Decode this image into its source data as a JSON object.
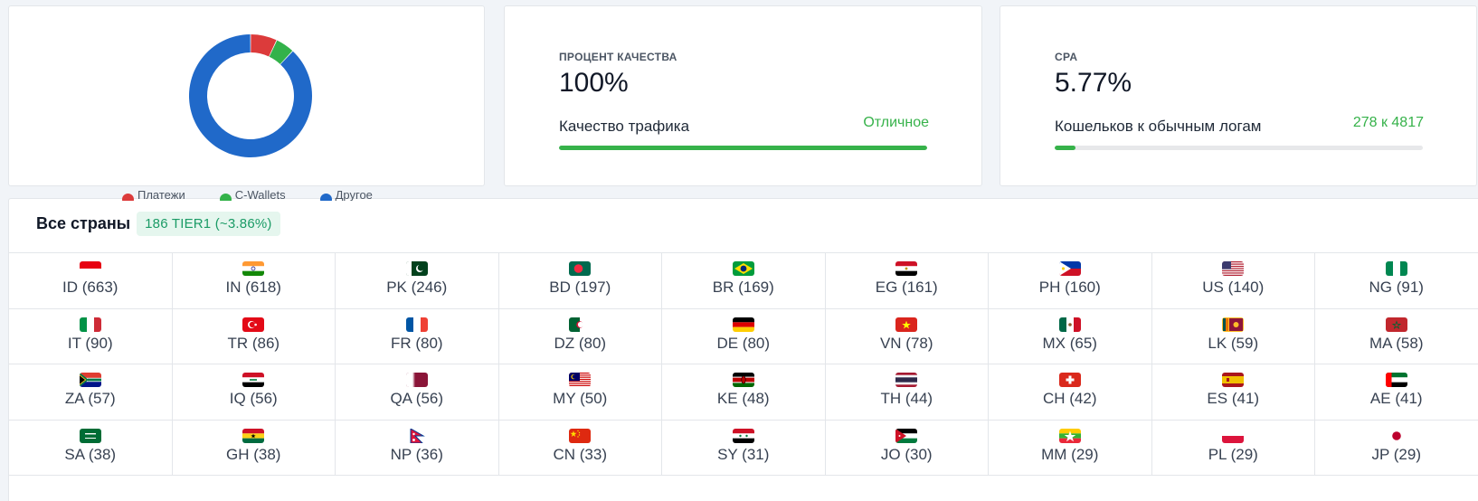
{
  "donut_card": {
    "segments": [
      {
        "name": "Платежи",
        "value": 7,
        "color": "#dc3b3b"
      },
      {
        "name": "C-Wallets",
        "value": 5,
        "color": "#33b24a"
      },
      {
        "name": "Другое",
        "value": 88,
        "color": "#2069c9"
      }
    ],
    "legend": [
      {
        "label": "Платежи",
        "color": "#dc3b3b"
      },
      {
        "label": "C-Wallets",
        "color": "#33b24a"
      },
      {
        "label": "Другое",
        "color": "#2069c9"
      }
    ]
  },
  "quality_card": {
    "title": "ПРОЦЕНТ КАЧЕСТВА",
    "value": "100%",
    "label": "Качество трафика",
    "status": "Отличное",
    "progress": 1.0
  },
  "cpa_card": {
    "title": "CPA",
    "value": "5.77%",
    "label": "Кошельков к обычным логам",
    "status": "278 к 4817",
    "progress": 0.0577
  },
  "countries": {
    "title": "Все страны",
    "badge": "186 TIER1 (~3.86%)",
    "items": [
      {
        "label": "ID (663)",
        "flag": "ID"
      },
      {
        "label": "IN (618)",
        "flag": "IN"
      },
      {
        "label": "PK (246)",
        "flag": "PK"
      },
      {
        "label": "BD (197)",
        "flag": "BD"
      },
      {
        "label": "BR (169)",
        "flag": "BR"
      },
      {
        "label": "EG (161)",
        "flag": "EG"
      },
      {
        "label": "PH (160)",
        "flag": "PH"
      },
      {
        "label": "US (140)",
        "flag": "US"
      },
      {
        "label": "NG (91)",
        "flag": "NG"
      },
      {
        "label": "IT (90)",
        "flag": "IT"
      },
      {
        "label": "TR (86)",
        "flag": "TR"
      },
      {
        "label": "FR (80)",
        "flag": "FR"
      },
      {
        "label": "DZ (80)",
        "flag": "DZ"
      },
      {
        "label": "DE (80)",
        "flag": "DE"
      },
      {
        "label": "VN (78)",
        "flag": "VN"
      },
      {
        "label": "MX (65)",
        "flag": "MX"
      },
      {
        "label": "LK (59)",
        "flag": "LK"
      },
      {
        "label": "MA (58)",
        "flag": "MA"
      },
      {
        "label": "ZA (57)",
        "flag": "ZA"
      },
      {
        "label": "IQ (56)",
        "flag": "IQ"
      },
      {
        "label": "QA (56)",
        "flag": "QA"
      },
      {
        "label": "MY (50)",
        "flag": "MY"
      },
      {
        "label": "KE (48)",
        "flag": "KE"
      },
      {
        "label": "TH (44)",
        "flag": "TH"
      },
      {
        "label": "CH (42)",
        "flag": "CH"
      },
      {
        "label": "ES (41)",
        "flag": "ES"
      },
      {
        "label": "AE (41)",
        "flag": "AE"
      },
      {
        "label": "SA (38)",
        "flag": "SA"
      },
      {
        "label": "GH (38)",
        "flag": "GH"
      },
      {
        "label": "NP (36)",
        "flag": "NP"
      },
      {
        "label": "CN (33)",
        "flag": "CN"
      },
      {
        "label": "SY (31)",
        "flag": "SY"
      },
      {
        "label": "JO (30)",
        "flag": "JO"
      },
      {
        "label": "MM (29)",
        "flag": "MM"
      },
      {
        "label": "PL (29)",
        "flag": "PL"
      },
      {
        "label": "JP (29)",
        "flag": "JP"
      }
    ]
  }
}
